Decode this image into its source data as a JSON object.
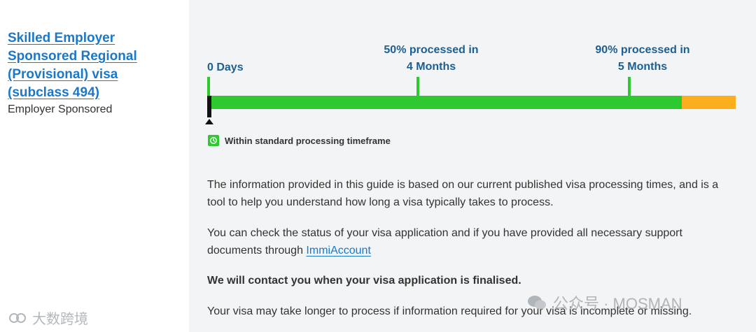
{
  "visa": {
    "title": "Skilled Employer Sponsored Regional (Provisional) visa (subclass 494)",
    "category": "Employer Sponsored"
  },
  "timeline": {
    "start_label": "0 Days",
    "milestone_50_line1": "50% processed in",
    "milestone_50_line2": "4 Months",
    "milestone_90_line1": "90% processed in",
    "milestone_90_line2": "5 Months",
    "colors": {
      "within": "#2ec92e",
      "beyond": "#fbaf1c",
      "marker": "#111111"
    }
  },
  "status": {
    "icon": "clock-check-icon",
    "text": "Within standard processing timeframe"
  },
  "content": {
    "para1": "The information provided in this guide is based on our current published visa processing times, and is a tool to help you understand how long a visa typically takes to process.",
    "para2_prefix": "You can check the status of your visa application and if you have provided all necessary support documents through ",
    "para2_link": "ImmiAccount",
    "para3": "We will contact you when your visa application is finalised.",
    "para4": "Your visa may take longer to process if information required for your visa is incomplete or missing."
  },
  "watermarks": {
    "left": "大数跨境",
    "right": "公众号 · MOSMAN"
  }
}
